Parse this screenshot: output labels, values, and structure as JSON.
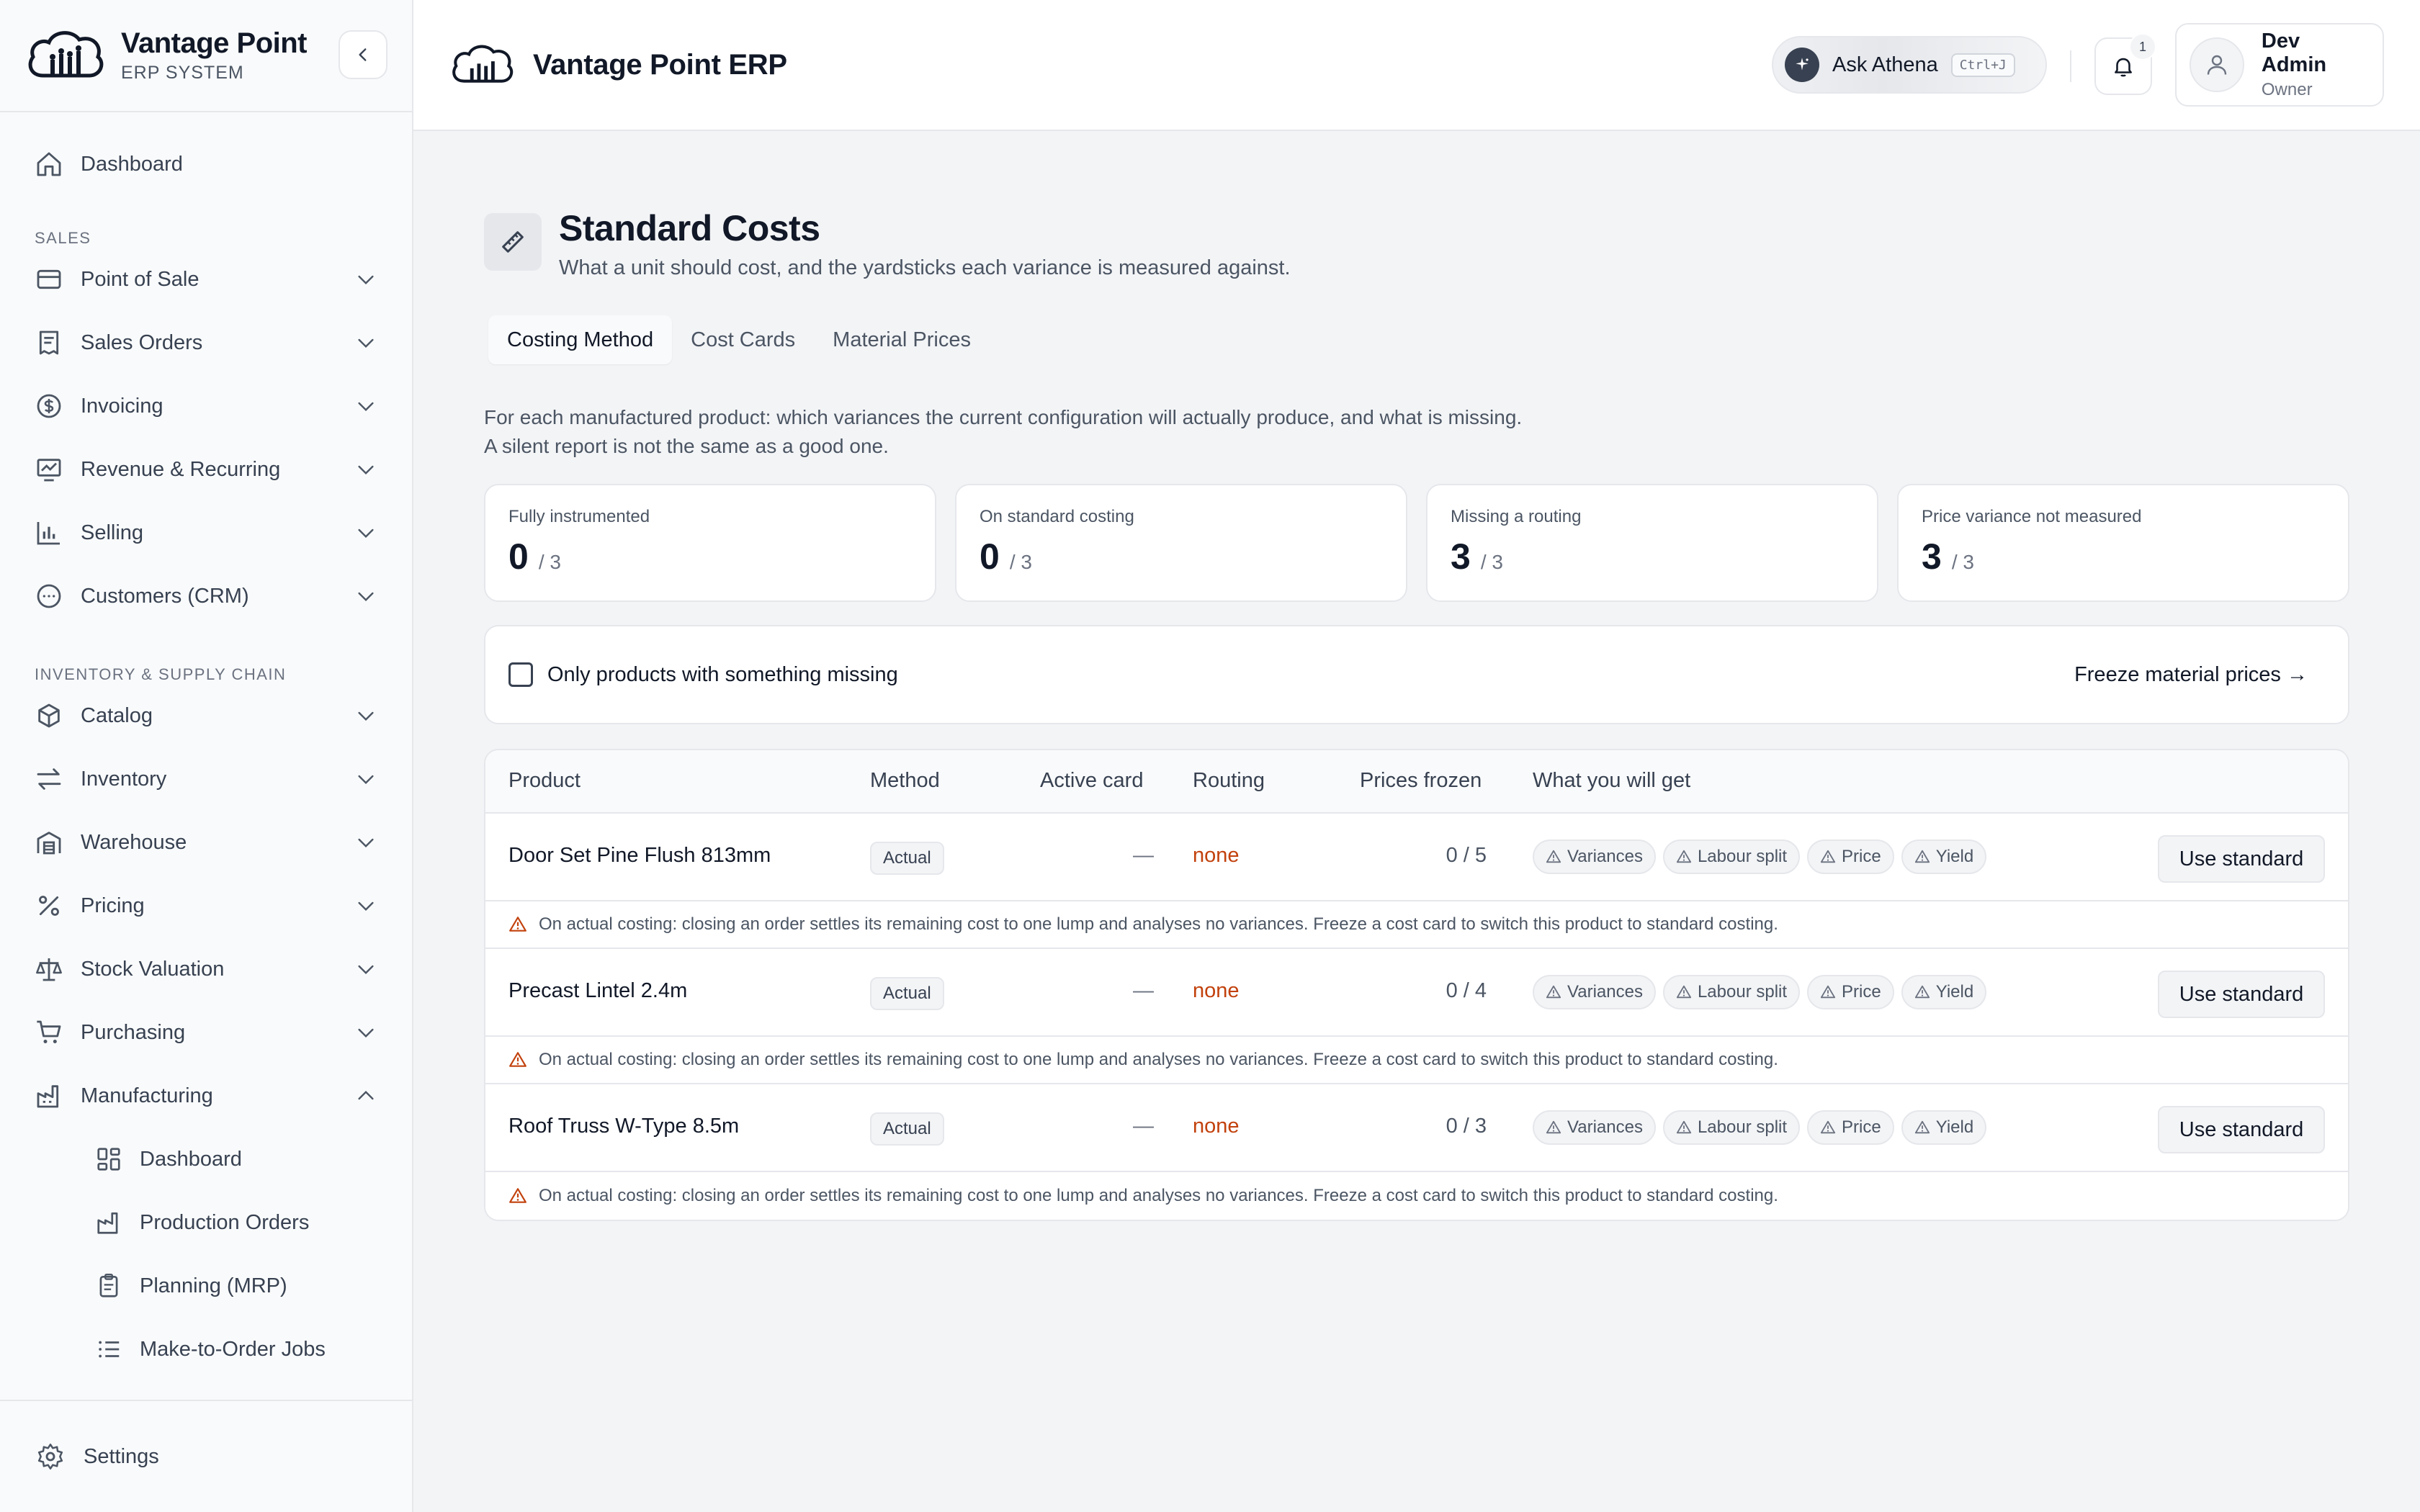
{
  "brand": {
    "name": "Vantage Point",
    "subtitle": "ERP SYSTEM"
  },
  "sidebar": {
    "top_item": {
      "label": "Dashboard",
      "icon": "home-icon"
    },
    "sections": [
      {
        "title": "SALES",
        "items": [
          {
            "label": "Point of Sale",
            "icon": "card-icon"
          },
          {
            "label": "Sales Orders",
            "icon": "receipt-icon"
          },
          {
            "label": "Invoicing",
            "icon": "dollar-icon"
          },
          {
            "label": "Revenue & Recurring",
            "icon": "chart-line-icon"
          },
          {
            "label": "Selling",
            "icon": "bar-chart-icon"
          },
          {
            "label": "Customers (CRM)",
            "icon": "chat-icon"
          }
        ]
      },
      {
        "title": "INVENTORY & SUPPLY CHAIN",
        "items": [
          {
            "label": "Catalog",
            "icon": "box-icon"
          },
          {
            "label": "Inventory",
            "icon": "arrows-icon"
          },
          {
            "label": "Warehouse",
            "icon": "warehouse-icon"
          },
          {
            "label": "Pricing",
            "icon": "percent-icon"
          },
          {
            "label": "Stock Valuation",
            "icon": "scale-icon"
          },
          {
            "label": "Purchasing",
            "icon": "cart-icon"
          },
          {
            "label": "Manufacturing",
            "icon": "factory-icon"
          }
        ]
      }
    ],
    "manufacturing_sub": [
      {
        "label": "Dashboard",
        "icon": "grid-icon"
      },
      {
        "label": "Production Orders",
        "icon": "factory-icon"
      },
      {
        "label": "Planning (MRP)",
        "icon": "clipboard-icon"
      },
      {
        "label": "Make-to-Order Jobs",
        "icon": "list-icon"
      }
    ],
    "settings_label": "Settings"
  },
  "topbar": {
    "title": "Vantage Point ERP",
    "ask_label": "Ask Athena",
    "ask_shortcut": "Ctrl+J",
    "notification_count": "1",
    "user_name": "Dev Admin",
    "user_role": "Owner"
  },
  "page": {
    "title": "Standard Costs",
    "subtitle": "What a unit should cost, and the yardsticks each variance is measured against.",
    "tabs": [
      "Costing Method",
      "Cost Cards",
      "Material Prices"
    ],
    "active_tab": "Costing Method",
    "description_line1": "For each manufactured product: which variances the current configuration will actually produce, and what is missing.",
    "description_line2": "A silent report is not the same as a good one."
  },
  "stats": [
    {
      "label": "Fully instrumented",
      "value": "0",
      "total": "/ 3"
    },
    {
      "label": "On standard costing",
      "value": "0",
      "total": "/ 3"
    },
    {
      "label": "Missing a routing",
      "value": "3",
      "total": "/ 3"
    },
    {
      "label": "Price variance not measured",
      "value": "3",
      "total": "/ 3"
    }
  ],
  "filter": {
    "checkbox_label": "Only products with something missing",
    "checked": false,
    "freeze_link": "Freeze material prices →"
  },
  "table": {
    "columns": [
      "Product",
      "Method",
      "Active card",
      "Routing",
      "Prices frozen",
      "What you will get"
    ],
    "chips": [
      "Variances",
      "Labour split",
      "Price",
      "Yield"
    ],
    "action_label": "Use standard",
    "warning": "On actual costing: closing an order settles its remaining cost to one lump and analyses no variances. Freeze a cost card to switch this product to standard costing.",
    "rows": [
      {
        "product": "Door Set Pine Flush 813mm",
        "method": "Actual",
        "active_card": "—",
        "routing": "none",
        "prices_frozen": "0 / 5"
      },
      {
        "product": "Precast Lintel 2.4m",
        "method": "Actual",
        "active_card": "—",
        "routing": "none",
        "prices_frozen": "0 / 4"
      },
      {
        "product": "Roof Truss W-Type 8.5m",
        "method": "Actual",
        "active_card": "—",
        "routing": "none",
        "prices_frozen": "0 / 3"
      }
    ]
  },
  "colors": {
    "routing_missing": "#c2410c",
    "warning_icon": "#c2410c",
    "text_primary": "#111827",
    "text_muted": "#4b5563"
  }
}
